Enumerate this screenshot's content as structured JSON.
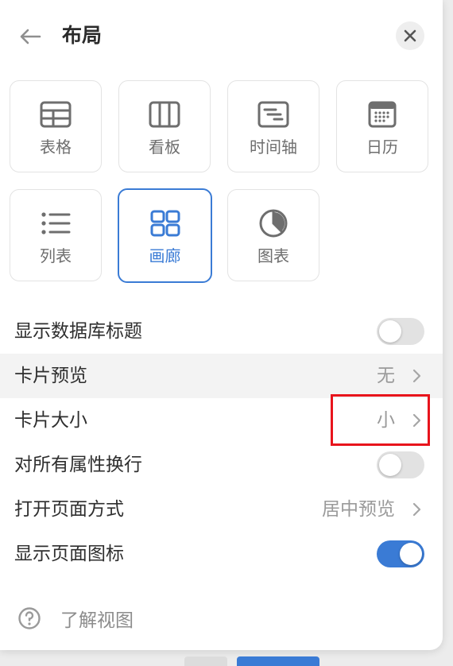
{
  "header": {
    "title": "布局",
    "back_icon": "arrow-left-icon",
    "close_icon": "close-icon"
  },
  "layouts": [
    {
      "label": "表格",
      "icon": "table-icon",
      "selected": false
    },
    {
      "label": "看板",
      "icon": "board-icon",
      "selected": false
    },
    {
      "label": "时间轴",
      "icon": "timeline-icon",
      "selected": false
    },
    {
      "label": "日历",
      "icon": "calendar-icon",
      "selected": false
    },
    {
      "label": "列表",
      "icon": "list-icon",
      "selected": false
    },
    {
      "label": "画廊",
      "icon": "gallery-icon",
      "selected": true
    },
    {
      "label": "图表",
      "icon": "chart-icon",
      "selected": false
    }
  ],
  "settings": {
    "show_db_title": {
      "label": "显示数据库标题",
      "toggle": false
    },
    "card_preview": {
      "label": "卡片预览",
      "value": "无"
    },
    "card_size": {
      "label": "卡片大小",
      "value": "小"
    },
    "wrap_props": {
      "label": "对所有属性换行",
      "toggle": false
    },
    "open_mode": {
      "label": "打开页面方式",
      "value": "居中预览"
    },
    "show_page_icon": {
      "label": "显示页面图标",
      "toggle": true
    }
  },
  "help": {
    "label": "了解视图",
    "icon": "help-circle-icon"
  },
  "colors": {
    "accent": "#3a7bd5",
    "highlight": "#e8141c"
  }
}
